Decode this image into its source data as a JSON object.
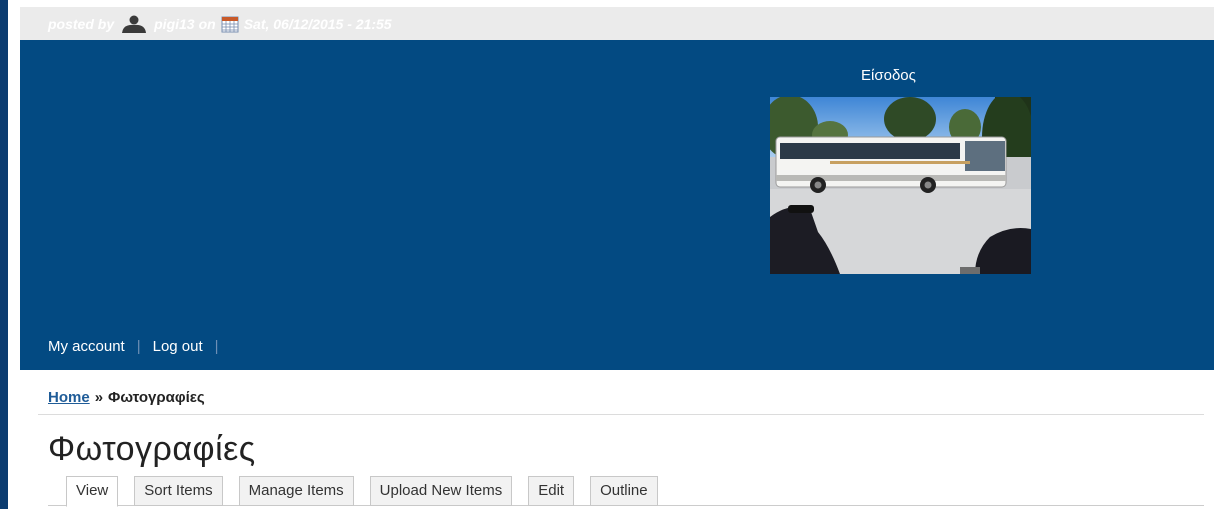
{
  "meta": {
    "posted_by_label": "posted by",
    "author": "pigi13",
    "on_label": "on",
    "date": "Sat, 06/12/2015 - 21:55"
  },
  "block": {
    "title": "Είσοδος",
    "image_subject": "bus-photo"
  },
  "user_menu": {
    "my_account": "My account",
    "log_out": "Log out",
    "separator": "|"
  },
  "breadcrumb": {
    "home": "Home",
    "separator": "»",
    "current": "Φωτογραφίες"
  },
  "page": {
    "title": "Φωτογραφίες"
  },
  "tabs": [
    {
      "label": "View",
      "active": true
    },
    {
      "label": "Sort Items",
      "active": false
    },
    {
      "label": "Manage Items",
      "active": false
    },
    {
      "label": "Upload New Items",
      "active": false
    },
    {
      "label": "Edit",
      "active": false
    },
    {
      "label": "Outline",
      "active": false
    }
  ],
  "colors": {
    "header_blue": "#034a82",
    "link_blue": "#1f5c98",
    "meta_bar": "#ebebeb"
  }
}
